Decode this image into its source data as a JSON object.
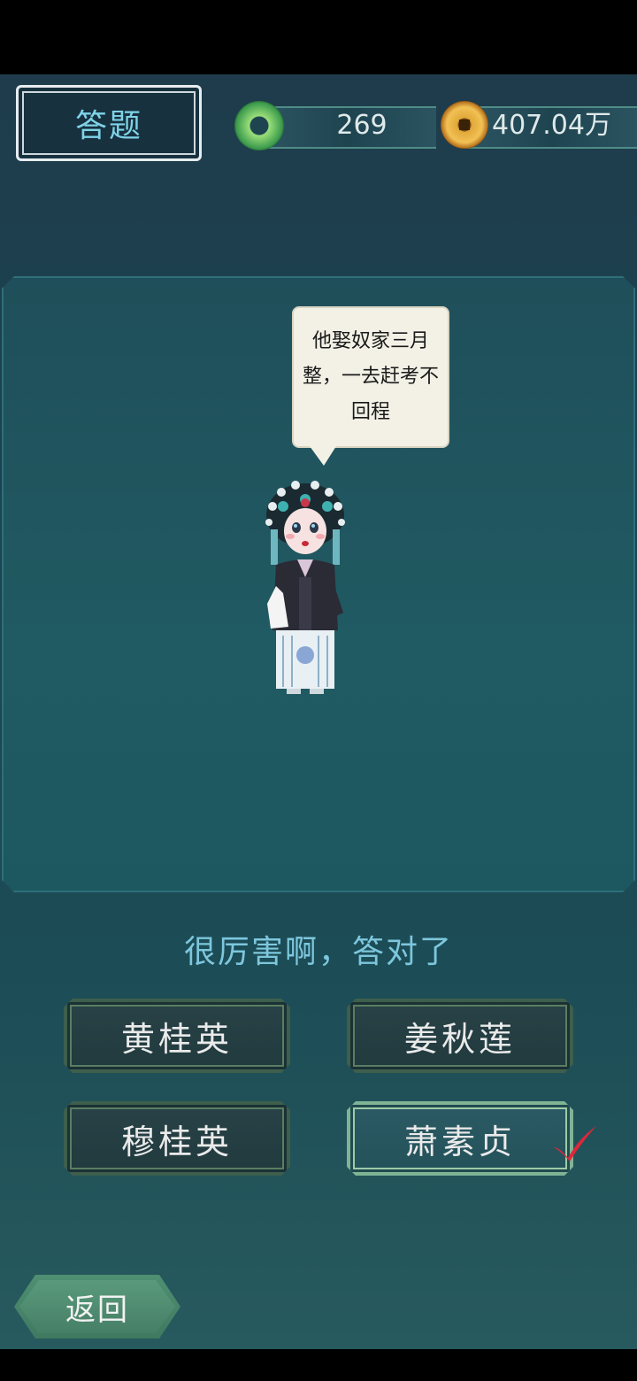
{
  "header": {
    "title": "答题",
    "jade_count": "269",
    "coin_count": "407.04万"
  },
  "stage": {
    "speech": "他娶奴家三月整，一去赶考不回程"
  },
  "result": {
    "message": "很厉害啊，答对了"
  },
  "answers": [
    {
      "label": "黄桂英",
      "state": "normal"
    },
    {
      "label": "姜秋莲",
      "state": "normal"
    },
    {
      "label": "穆桂英",
      "state": "normal"
    },
    {
      "label": "萧素贞",
      "state": "correct"
    }
  ],
  "footer": {
    "back_label": "返回"
  },
  "colors": {
    "accent": "#7dc7dd",
    "check": "#e0263a"
  }
}
